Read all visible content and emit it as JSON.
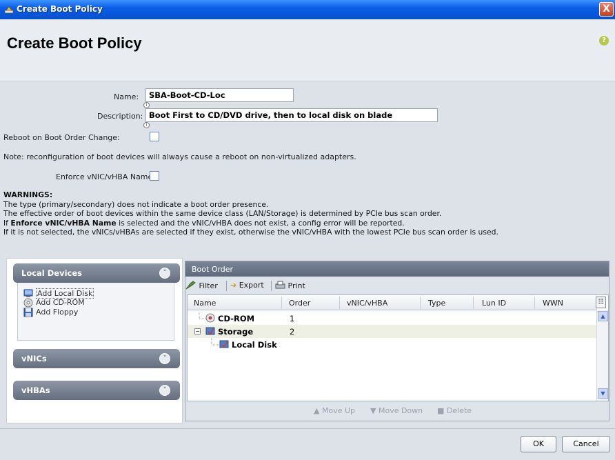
{
  "window": {
    "title": "Create Boot Policy",
    "close_glyph": "X"
  },
  "header": {
    "title": "Create Boot Policy",
    "help_glyph": "?"
  },
  "form": {
    "name_label": "Name:",
    "name_value": "SBA-Boot-CD-Loc",
    "description_label": "Description:",
    "description_value": "Boot First to CD/DVD drive, then to local disk on blade",
    "info_glyph": "i",
    "reboot_label": "Reboot on Boot Order Change:",
    "reboot_checked": false,
    "note": "Note: reconfiguration of boot devices will always cause a reboot on non-virtualized adapters.",
    "enforce_label": "Enforce vNIC/vHBA Name:",
    "enforce_checked": false
  },
  "warnings": {
    "heading": "WARNINGS:",
    "line1": "The type (primary/secondary) does not indicate a boot order presence.",
    "line2": "The effective order of boot devices within the same device class (LAN/Storage) is determined by PCIe bus scan order.",
    "line3_pre": "If ",
    "line3_bold": "Enforce vNIC/vHBA Name",
    "line3_post": " is selected and the vNIC/vHBA does not exist, a config error will be reported.",
    "line4": "If it is not selected, the vNICs/vHBAs are selected if they exist, otherwise the vNIC/vHBA with the lowest PCIe bus scan order is used."
  },
  "left_panel": {
    "local_devices": {
      "title": "Local Devices",
      "items": [
        {
          "label": "Add Local Disk",
          "icon": "local-disk-icon"
        },
        {
          "label": "Add CD-ROM",
          "icon": "cdrom-icon"
        },
        {
          "label": "Add Floppy",
          "icon": "floppy-icon"
        }
      ]
    },
    "vnics": {
      "title": "vNICs"
    },
    "vhbas": {
      "title": "vHBAs"
    }
  },
  "boot_order": {
    "title": "Boot Order",
    "toolbar": {
      "filter": "Filter",
      "export": "Export",
      "print": "Print"
    },
    "columns": [
      "Name",
      "Order",
      "vNIC/vHBA",
      "Type",
      "Lun ID",
      "WWN"
    ],
    "rows": [
      {
        "name": "CD-ROM",
        "order": "1",
        "icon": "cdrom-icon",
        "level": 0
      },
      {
        "name": "Storage",
        "order": "2",
        "icon": "storage-icon",
        "level": 0,
        "expanded": true
      },
      {
        "name": "Local Disk",
        "order": "",
        "icon": "local-disk-icon",
        "level": 1
      }
    ],
    "actions": {
      "move_up": "Move Up",
      "move_down": "Move Down",
      "delete": "Delete"
    }
  },
  "footer": {
    "ok": "OK",
    "cancel": "Cancel"
  },
  "colors": {
    "titlebar": "#0a5fe6",
    "panel_header": "#6b7586",
    "form_bg": "#dde1e8"
  }
}
